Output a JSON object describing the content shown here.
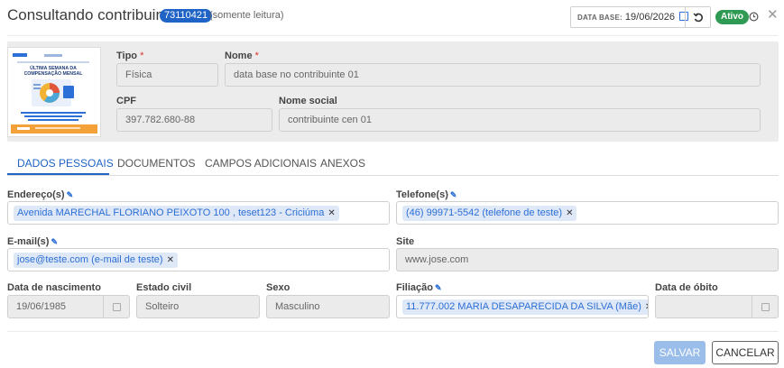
{
  "header": {
    "title": "Consultando contribuinte",
    "id_badge": "73110421",
    "readonly_note": "(somente leitura)",
    "data_base_label": "DATA BASE:",
    "data_base_value": "19/06/2026",
    "status": "Ativo"
  },
  "thumbnail": {
    "line1": "ÚLTIMA SEMANA DA",
    "line2": "COMPENSAÇÃO MENSAL"
  },
  "identity": {
    "tipo_label": "Tipo",
    "tipo_value": "Física",
    "nome_label": "Nome",
    "nome_value": "data base no contribuinte 01",
    "cpf_label": "CPF",
    "cpf_value": "397.782.680-88",
    "nome_social_label": "Nome social",
    "nome_social_value": "contribuinte cen 01",
    "required_mark": "*"
  },
  "tabs": [
    {
      "label": "DADOS PESSOAIS"
    },
    {
      "label": "DOCUMENTOS"
    },
    {
      "label": "CAMPOS ADICIONAIS"
    },
    {
      "label": "ANEXOS"
    }
  ],
  "form": {
    "enderecos_label": "Endereço(s)",
    "endereco_chip": "Avenida MARECHAL FLORIANO PEIXOTO 100 , teset123 - Criciúma",
    "telefones_label": "Telefone(s)",
    "telefone_chip": "(46) 99971-5542 (telefone de teste)",
    "emails_label": "E-mail(s)",
    "email_chip": "jose@teste.com (e-mail de teste)",
    "site_label": "Site",
    "site_value": "www.jose.com",
    "nascimento_label": "Data de nascimento",
    "nascimento_value": "19/06/1985",
    "estado_civil_label": "Estado civil",
    "estado_civil_value": "Solteiro",
    "sexo_label": "Sexo",
    "sexo_value": "Masculino",
    "filiacao_label": "Filiação",
    "filiacao_chip": "11.777.002 MARIA DESAPARECIDA DA SILVA (Mãe)",
    "obito_label": "Data de óbito",
    "obito_value": ""
  },
  "actions": {
    "save": "SALVAR",
    "cancel": "CANCELAR"
  },
  "colors": {
    "accent": "#1f63c6",
    "status_green": "#2e9a54",
    "chip_bg": "#dfe8f7",
    "annotation_arrow": "#e02020"
  }
}
